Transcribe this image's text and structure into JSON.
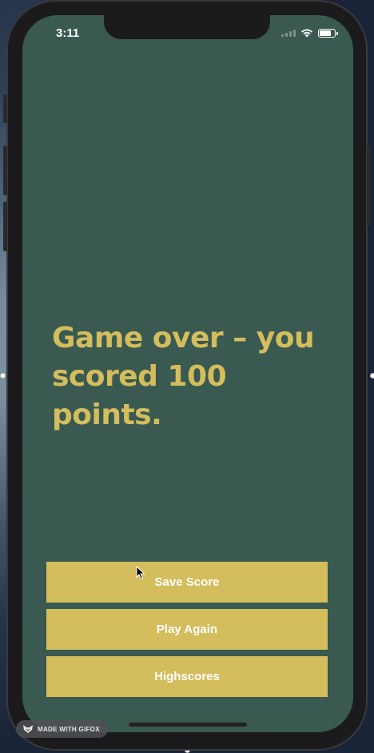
{
  "status_bar": {
    "time": "3:11",
    "battery_level": 0.85
  },
  "game_over": {
    "message": "Game over – you scored 100 points."
  },
  "buttons": {
    "save_score": "Save Score",
    "play_again": "Play Again",
    "highscores": "Highscores"
  },
  "watermark": {
    "label": "MADE WITH GIFOX"
  },
  "colors": {
    "screen_background": "#3a5951",
    "accent": "#d4bd5c",
    "button_text": "#ffffff"
  }
}
